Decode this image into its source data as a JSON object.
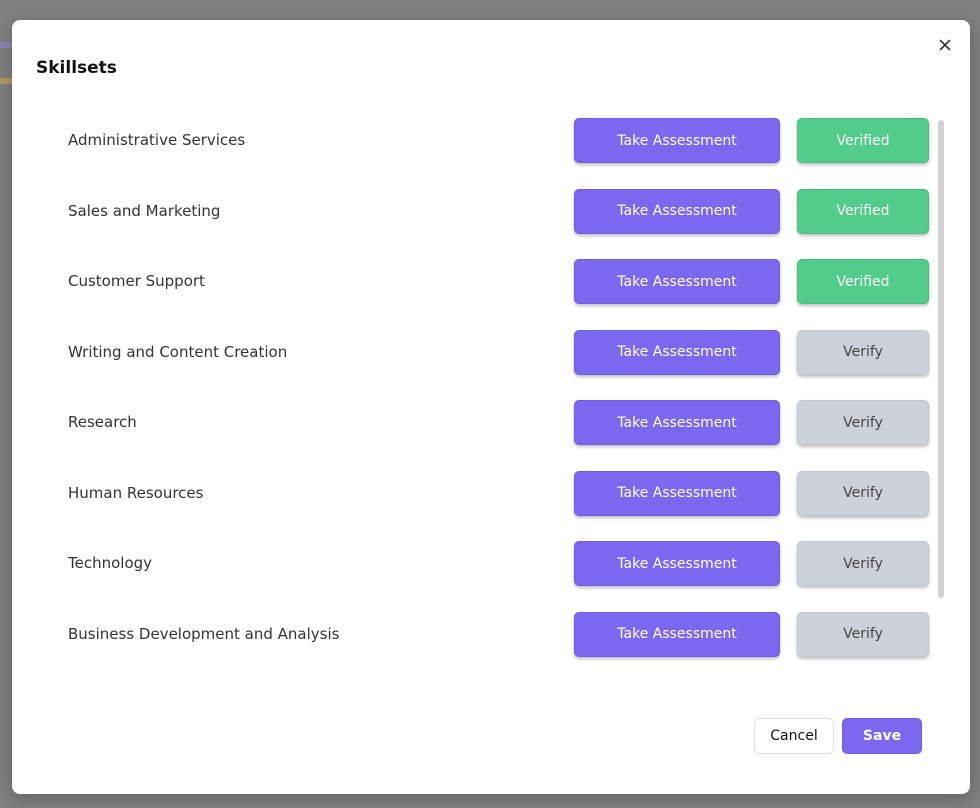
{
  "modal": {
    "title": "Skillsets",
    "close_icon": "close-icon"
  },
  "skills": [
    {
      "name": "Administrative Services",
      "assess_label": "Take Assessment",
      "verify_label": "Verified",
      "verified": true
    },
    {
      "name": "Sales and Marketing",
      "assess_label": "Take Assessment",
      "verify_label": "Verified",
      "verified": true
    },
    {
      "name": "Customer Support",
      "assess_label": "Take Assessment",
      "verify_label": "Verified",
      "verified": true
    },
    {
      "name": "Writing and Content Creation",
      "assess_label": "Take Assessment",
      "verify_label": "Verify",
      "verified": false
    },
    {
      "name": "Research",
      "assess_label": "Take Assessment",
      "verify_label": "Verify",
      "verified": false
    },
    {
      "name": "Human Resources",
      "assess_label": "Take Assessment",
      "verify_label": "Verify",
      "verified": false
    },
    {
      "name": "Technology",
      "assess_label": "Take Assessment",
      "verify_label": "Verify",
      "verified": false
    },
    {
      "name": "Business Development and Analysis",
      "assess_label": "Take Assessment",
      "verify_label": "Verify",
      "verified": false
    }
  ],
  "footer": {
    "cancel_label": "Cancel",
    "save_label": "Save"
  },
  "colors": {
    "primary": "#7b68ee",
    "verified": "#52cc8a",
    "pending": "#cdd2da",
    "overlay": "#808080"
  }
}
